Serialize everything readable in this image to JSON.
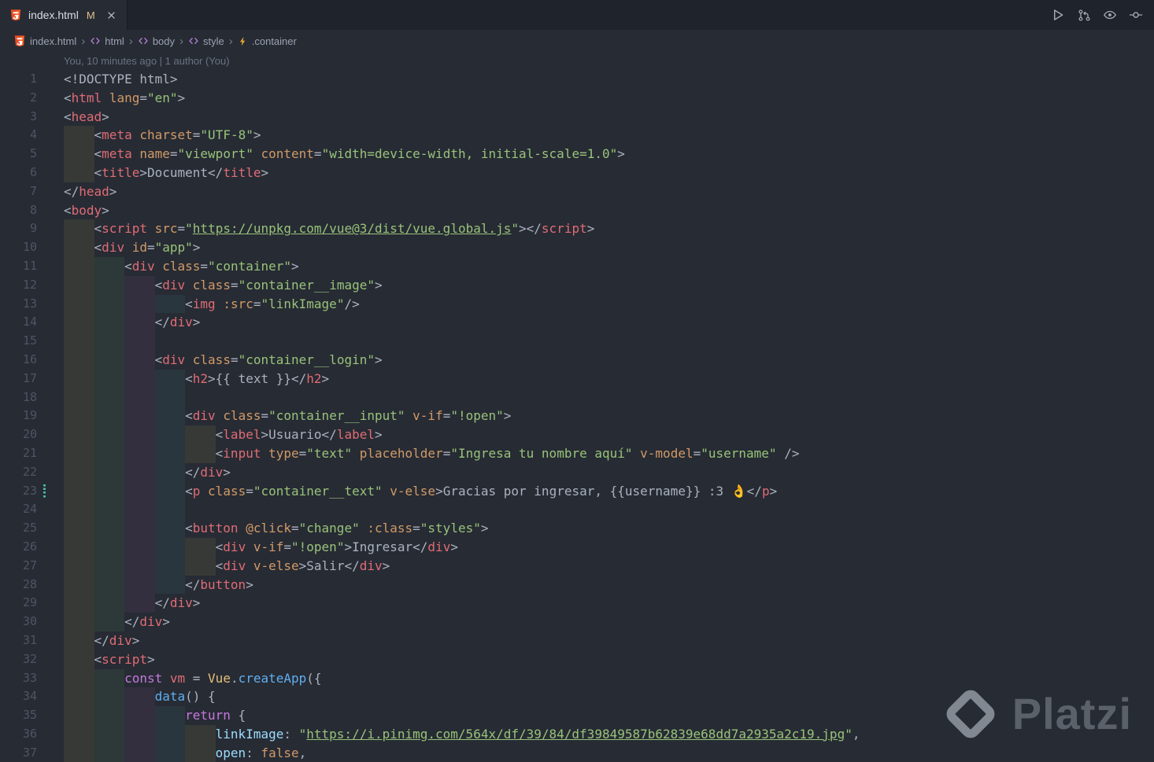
{
  "tab": {
    "title": "index.html",
    "modified_badge": "M"
  },
  "editor_actions": [
    {
      "icon": "run",
      "name": "run-code"
    },
    {
      "icon": "open-changes",
      "name": "open-changes"
    },
    {
      "icon": "toggle-blame",
      "name": "toggle-file-blame"
    },
    {
      "icon": "commit-graph",
      "name": "commit-graph"
    }
  ],
  "breadcrumbs": {
    "separator": "›",
    "items": [
      {
        "icon": "html-file",
        "label": "index.html"
      },
      {
        "icon": "element",
        "label": "html"
      },
      {
        "icon": "element",
        "label": "body"
      },
      {
        "icon": "element",
        "label": "style"
      },
      {
        "icon": "event",
        "label": ".container"
      }
    ]
  },
  "blame": {
    "text": "You, 10 minutes ago | 1 author (You)"
  },
  "watermark": {
    "text": "Platzi"
  },
  "colors": {
    "background": "#272b34",
    "tabbar_background": "#1f232b",
    "tag": "#e06c75",
    "attribute": "#d19a66",
    "string": "#98c379",
    "keyword": "#c678dd",
    "function": "#61afef",
    "class_name": "#e5c07b",
    "modified_badge": "#e2c08d",
    "html_icon": "#e44d26",
    "gutter_marker": "#41c3a5"
  },
  "editor": {
    "lines": [
      {
        "n": 1,
        "i": 0,
        "t": [
          [
            "p",
            "<!DOCTYPE html>"
          ]
        ]
      },
      {
        "n": 2,
        "i": 0,
        "t": [
          [
            "p",
            "<"
          ],
          [
            "tag",
            "html"
          ],
          [
            "p",
            " "
          ],
          [
            "attr",
            "lang"
          ],
          [
            "p",
            "="
          ],
          [
            "str",
            "\"en\""
          ],
          [
            "p",
            ">"
          ]
        ]
      },
      {
        "n": 3,
        "i": 0,
        "t": [
          [
            "p",
            "<"
          ],
          [
            "tag",
            "head"
          ],
          [
            "p",
            ">"
          ]
        ]
      },
      {
        "n": 4,
        "i": 1,
        "t": [
          [
            "p",
            "<"
          ],
          [
            "tag",
            "meta"
          ],
          [
            "p",
            " "
          ],
          [
            "attr",
            "charset"
          ],
          [
            "p",
            "="
          ],
          [
            "str",
            "\"UTF-8\""
          ],
          [
            "p",
            ">"
          ]
        ]
      },
      {
        "n": 5,
        "i": 1,
        "t": [
          [
            "p",
            "<"
          ],
          [
            "tag",
            "meta"
          ],
          [
            "p",
            " "
          ],
          [
            "attr",
            "name"
          ],
          [
            "p",
            "="
          ],
          [
            "str",
            "\"viewport\""
          ],
          [
            "p",
            " "
          ],
          [
            "attr",
            "content"
          ],
          [
            "p",
            "="
          ],
          [
            "str",
            "\"width=device-width, initial-scale=1.0\""
          ],
          [
            "p",
            ">"
          ]
        ]
      },
      {
        "n": 6,
        "i": 1,
        "t": [
          [
            "p",
            "<"
          ],
          [
            "tag",
            "title"
          ],
          [
            "p",
            ">"
          ],
          [
            "txt",
            "Document"
          ],
          [
            "p",
            "</"
          ],
          [
            "tag",
            "title"
          ],
          [
            "p",
            ">"
          ]
        ]
      },
      {
        "n": 7,
        "i": 0,
        "t": [
          [
            "p",
            "</"
          ],
          [
            "tag",
            "head"
          ],
          [
            "p",
            ">"
          ]
        ]
      },
      {
        "n": 8,
        "i": 0,
        "t": [
          [
            "p",
            "<"
          ],
          [
            "tag",
            "body"
          ],
          [
            "p",
            ">"
          ]
        ]
      },
      {
        "n": 9,
        "i": 1,
        "t": [
          [
            "p",
            "<"
          ],
          [
            "tag",
            "script"
          ],
          [
            "p",
            " "
          ],
          [
            "attr",
            "src"
          ],
          [
            "p",
            "="
          ],
          [
            "str",
            "\""
          ],
          [
            "link",
            "https://unpkg.com/vue@3/dist/vue.global.js"
          ],
          [
            "str",
            "\""
          ],
          [
            "p",
            ">"
          ],
          [
            "p",
            "</"
          ],
          [
            "tag",
            "script"
          ],
          [
            "p",
            ">"
          ]
        ]
      },
      {
        "n": 10,
        "i": 1,
        "t": [
          [
            "p",
            "<"
          ],
          [
            "tag",
            "div"
          ],
          [
            "p",
            " "
          ],
          [
            "attr",
            "id"
          ],
          [
            "p",
            "="
          ],
          [
            "str",
            "\"app\""
          ],
          [
            "p",
            ">"
          ]
        ]
      },
      {
        "n": 11,
        "i": 2,
        "t": [
          [
            "p",
            "<"
          ],
          [
            "tag",
            "div"
          ],
          [
            "p",
            " "
          ],
          [
            "attr",
            "class"
          ],
          [
            "p",
            "="
          ],
          [
            "str",
            "\"container\""
          ],
          [
            "p",
            ">"
          ]
        ]
      },
      {
        "n": 12,
        "i": 3,
        "t": [
          [
            "p",
            "<"
          ],
          [
            "tag",
            "div"
          ],
          [
            "p",
            " "
          ],
          [
            "attr",
            "class"
          ],
          [
            "p",
            "="
          ],
          [
            "str",
            "\"container__image\""
          ],
          [
            "p",
            ">"
          ]
        ]
      },
      {
        "n": 13,
        "i": 4,
        "t": [
          [
            "p",
            "<"
          ],
          [
            "tag",
            "img"
          ],
          [
            "p",
            " "
          ],
          [
            "attr",
            ":src"
          ],
          [
            "p",
            "="
          ],
          [
            "str",
            "\"linkImage\""
          ],
          [
            "p",
            "/>"
          ]
        ]
      },
      {
        "n": 14,
        "i": 3,
        "t": [
          [
            "p",
            "</"
          ],
          [
            "tag",
            "div"
          ],
          [
            "p",
            ">"
          ]
        ]
      },
      {
        "n": 15,
        "i": 3,
        "t": []
      },
      {
        "n": 16,
        "i": 3,
        "t": [
          [
            "p",
            "<"
          ],
          [
            "tag",
            "div"
          ],
          [
            "p",
            " "
          ],
          [
            "attr",
            "class"
          ],
          [
            "p",
            "="
          ],
          [
            "str",
            "\"container__login\""
          ],
          [
            "p",
            ">"
          ]
        ]
      },
      {
        "n": 17,
        "i": 4,
        "t": [
          [
            "p",
            "<"
          ],
          [
            "tag",
            "h2"
          ],
          [
            "p",
            ">"
          ],
          [
            "txt",
            "{{ text }}"
          ],
          [
            "p",
            "</"
          ],
          [
            "tag",
            "h2"
          ],
          [
            "p",
            ">"
          ]
        ]
      },
      {
        "n": 18,
        "i": 4,
        "t": []
      },
      {
        "n": 19,
        "i": 4,
        "t": [
          [
            "p",
            "<"
          ],
          [
            "tag",
            "div"
          ],
          [
            "p",
            " "
          ],
          [
            "attr",
            "class"
          ],
          [
            "p",
            "="
          ],
          [
            "str",
            "\"container__input\""
          ],
          [
            "p",
            " "
          ],
          [
            "attr",
            "v-if"
          ],
          [
            "p",
            "="
          ],
          [
            "str",
            "\"!open\""
          ],
          [
            "p",
            ">"
          ]
        ]
      },
      {
        "n": 20,
        "i": 5,
        "t": [
          [
            "p",
            "<"
          ],
          [
            "tag",
            "label"
          ],
          [
            "p",
            ">"
          ],
          [
            "txt",
            "Usuario"
          ],
          [
            "p",
            "</"
          ],
          [
            "tag",
            "label"
          ],
          [
            "p",
            ">"
          ]
        ]
      },
      {
        "n": 21,
        "i": 5,
        "t": [
          [
            "p",
            "<"
          ],
          [
            "tag",
            "input"
          ],
          [
            "p",
            " "
          ],
          [
            "attr",
            "type"
          ],
          [
            "p",
            "="
          ],
          [
            "str",
            "\"text\""
          ],
          [
            "p",
            " "
          ],
          [
            "attr",
            "placeholder"
          ],
          [
            "p",
            "="
          ],
          [
            "str",
            "\"Ingresa tu nombre aquí\""
          ],
          [
            "p",
            " "
          ],
          [
            "attr",
            "v-model"
          ],
          [
            "p",
            "="
          ],
          [
            "str",
            "\"username\""
          ],
          [
            "p",
            " />"
          ]
        ]
      },
      {
        "n": 22,
        "i": 4,
        "t": [
          [
            "p",
            "</"
          ],
          [
            "tag",
            "div"
          ],
          [
            "p",
            ">"
          ]
        ]
      },
      {
        "n": 23,
        "i": 4,
        "m": true,
        "t": [
          [
            "p",
            "<"
          ],
          [
            "tag",
            "p"
          ],
          [
            "p",
            " "
          ],
          [
            "attr",
            "class"
          ],
          [
            "p",
            "="
          ],
          [
            "str",
            "\"container__text\""
          ],
          [
            "p",
            " "
          ],
          [
            "attr",
            "v-else"
          ],
          [
            "p",
            ">"
          ],
          [
            "txt",
            "Gracias por ingresar, {{username}} :3 "
          ],
          [
            "emoji",
            "👌"
          ],
          [
            "p",
            "</"
          ],
          [
            "tag",
            "p"
          ],
          [
            "p",
            ">"
          ]
        ]
      },
      {
        "n": 24,
        "i": 4,
        "t": []
      },
      {
        "n": 25,
        "i": 4,
        "t": [
          [
            "p",
            "<"
          ],
          [
            "tag",
            "button"
          ],
          [
            "p",
            " "
          ],
          [
            "attr",
            "@click"
          ],
          [
            "p",
            "="
          ],
          [
            "str",
            "\"change\""
          ],
          [
            "p",
            " "
          ],
          [
            "attr",
            ":class"
          ],
          [
            "p",
            "="
          ],
          [
            "str",
            "\"styles\""
          ],
          [
            "p",
            ">"
          ]
        ]
      },
      {
        "n": 26,
        "i": 5,
        "t": [
          [
            "p",
            "<"
          ],
          [
            "tag",
            "div"
          ],
          [
            "p",
            " "
          ],
          [
            "attr",
            "v-if"
          ],
          [
            "p",
            "="
          ],
          [
            "str",
            "\"!open\""
          ],
          [
            "p",
            ">"
          ],
          [
            "txt",
            "Ingresar"
          ],
          [
            "p",
            "</"
          ],
          [
            "tag",
            "div"
          ],
          [
            "p",
            ">"
          ]
        ]
      },
      {
        "n": 27,
        "i": 5,
        "t": [
          [
            "p",
            "<"
          ],
          [
            "tag",
            "div"
          ],
          [
            "p",
            " "
          ],
          [
            "attr",
            "v-else"
          ],
          [
            "p",
            ">"
          ],
          [
            "txt",
            "Salir"
          ],
          [
            "p",
            "</"
          ],
          [
            "tag",
            "div"
          ],
          [
            "p",
            ">"
          ]
        ]
      },
      {
        "n": 28,
        "i": 4,
        "t": [
          [
            "p",
            "</"
          ],
          [
            "tag",
            "button"
          ],
          [
            "p",
            ">"
          ]
        ]
      },
      {
        "n": 29,
        "i": 3,
        "t": [
          [
            "p",
            "</"
          ],
          [
            "tag",
            "div"
          ],
          [
            "p",
            ">"
          ]
        ]
      },
      {
        "n": 30,
        "i": 2,
        "t": [
          [
            "p",
            "</"
          ],
          [
            "tag",
            "div"
          ],
          [
            "p",
            ">"
          ]
        ]
      },
      {
        "n": 31,
        "i": 1,
        "t": [
          [
            "p",
            "</"
          ],
          [
            "tag",
            "div"
          ],
          [
            "p",
            ">"
          ]
        ]
      },
      {
        "n": 32,
        "i": 1,
        "t": [
          [
            "p",
            "<"
          ],
          [
            "tag",
            "script"
          ],
          [
            "p",
            ">"
          ]
        ]
      },
      {
        "n": 33,
        "i": 2,
        "t": [
          [
            "kw",
            "const"
          ],
          [
            "p",
            " "
          ],
          [
            "var",
            "vm"
          ],
          [
            "p",
            " = "
          ],
          [
            "cls",
            "Vue"
          ],
          [
            "p",
            "."
          ],
          [
            "fn",
            "createApp"
          ],
          [
            "p",
            "({"
          ]
        ]
      },
      {
        "n": 34,
        "i": 3,
        "t": [
          [
            "fn",
            "data"
          ],
          [
            "p",
            "() {"
          ]
        ]
      },
      {
        "n": 35,
        "i": 4,
        "t": [
          [
            "kw",
            "return"
          ],
          [
            "p",
            " {"
          ]
        ]
      },
      {
        "n": 36,
        "i": 5,
        "t": [
          [
            "key",
            "linkImage"
          ],
          [
            "p",
            ": "
          ],
          [
            "str",
            "\""
          ],
          [
            "link",
            "https://i.pinimg.com/564x/df/39/84/df39849587b62839e68dd7a2935a2c19.jpg"
          ],
          [
            "str",
            "\""
          ],
          [
            "p",
            ","
          ]
        ]
      },
      {
        "n": 37,
        "i": 5,
        "t": [
          [
            "key",
            "open"
          ],
          [
            "p",
            ": "
          ],
          [
            "const",
            "false"
          ],
          [
            "p",
            ","
          ]
        ]
      }
    ]
  }
}
